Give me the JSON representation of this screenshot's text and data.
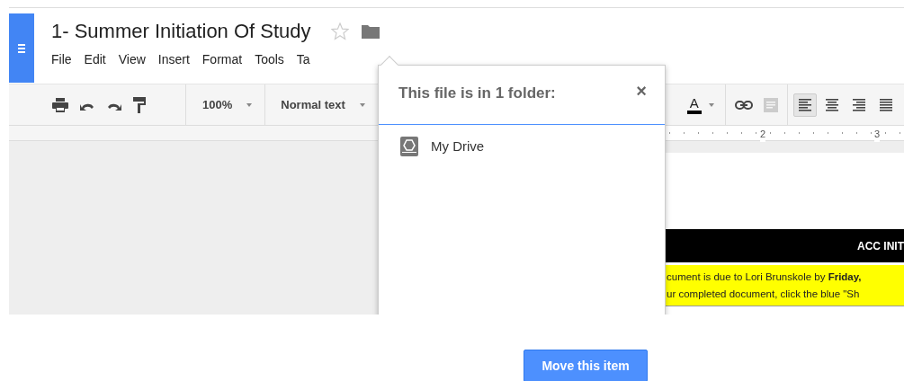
{
  "document": {
    "title": "1- Summer Initiation Of Study",
    "starred": false
  },
  "menu": [
    "File",
    "Edit",
    "View",
    "Insert",
    "Format",
    "Tools",
    "Ta"
  ],
  "toolbar": {
    "zoom": "100%",
    "style": "Normal text",
    "text_color_label": "A",
    "comment_disabled": true,
    "alignments": [
      {
        "selected": true
      },
      {
        "selected": false
      },
      {
        "selected": false
      },
      {
        "selected": false
      }
    ]
  },
  "ruler": [
    "2",
    "3"
  ],
  "page": {
    "banner": "ACC INIT",
    "notice_lines": [
      "cument is due to Lori Brunskole by **Friday,**",
      "ur completed document, click the blue \"Sh"
    ]
  },
  "folder_popup": {
    "title": "This file is in 1 folder:",
    "close": "×",
    "folders": [
      {
        "name": "My Drive"
      }
    ]
  },
  "move_button": "Move this item"
}
